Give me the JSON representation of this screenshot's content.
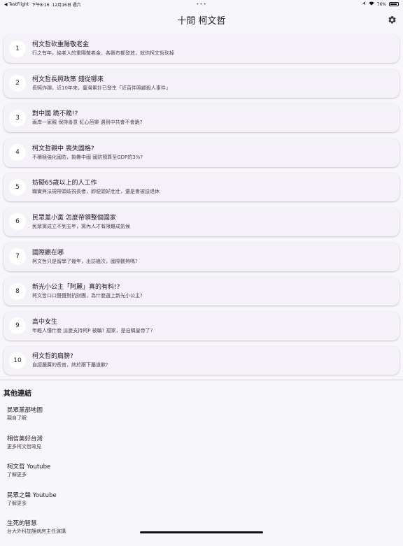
{
  "status_bar": {
    "carrier": "◀ TestFlight",
    "time": "下午8:16",
    "date": "12月16日 週六",
    "dots": "•••",
    "battery": "76%"
  },
  "app_bar": {
    "title": "十問 柯文哲",
    "settings_icon": "gear-icon"
  },
  "questions": [
    {
      "num": "1",
      "title": "柯文哲砍重陽敬老金",
      "subtitle": "行之有年，給老人的重陽敬老金、各縣市都發放，就你柯文哲砍掉"
    },
    {
      "num": "2",
      "title": "柯文哲長照政策 錢從哪來",
      "subtitle": "長照炸彈，近10年來，臺灣累計已發生「近百件照顧殺人事件」"
    },
    {
      "num": "3",
      "title": "對中國 跪不跪!?",
      "subtitle": "兩岸一家親 保持善意 紅心芭樂 遇到中共會不會跪?"
    },
    {
      "num": "4",
      "title": "柯文哲親中 喪失國格?",
      "subtitle": "不積極強化國防，挑釁中國 國防預算至GDP的3%?"
    },
    {
      "num": "5",
      "title": "妨礙65歲以上的人工作",
      "subtitle": "職實與法規帶頭歧視長者，即便頭好壯壯，還是會被迫退休"
    },
    {
      "num": "6",
      "title": "民眾黨小黨 怎麼帶領整個國家",
      "subtitle": "民眾黨成立不到五年，黨內人才有限難成氣候"
    },
    {
      "num": "7",
      "title": "國際觀在哪",
      "subtitle": "柯文哲只是留學了幾年，出訪幾次，國際觀夠嗎?"
    },
    {
      "num": "8",
      "title": "新光小公主「阿麗」真的有料!?",
      "subtitle": "柯文哲口口聲聲對抗財團，為什麼選上新光小公主?"
    },
    {
      "num": "9",
      "title": "高中女生",
      "subtitle": "年輕人懂什麼 這麼支持柯P 被騙?  孤家，是自稱皇帝了?"
    },
    {
      "num": "10",
      "title": "柯文哲的肩膀?",
      "subtitle": "自認嚴厲的長官，終於跟下屬道歉?"
    }
  ],
  "links_section": {
    "header": "其他連結",
    "items": [
      {
        "title": "民眾黨部地圖",
        "subtitle": "親自了解"
      },
      {
        "title": "相信美好台灣",
        "subtitle": "更多柯文哲政見"
      },
      {
        "title": "柯文哲 Youtube",
        "subtitle": "了解更多"
      },
      {
        "title": "民眾之聲 Youtube",
        "subtitle": "了解更多"
      },
      {
        "title": "生死的智慧",
        "subtitle": "台大外科加護病房主任演講"
      }
    ]
  }
}
